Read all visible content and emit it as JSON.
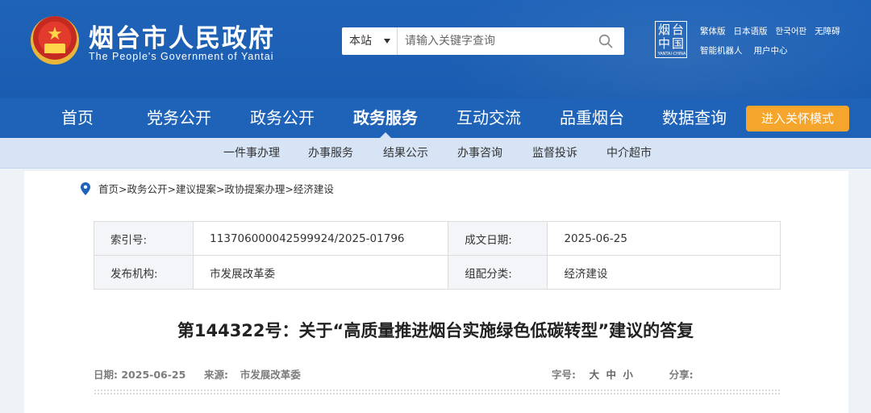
{
  "header": {
    "site_name": "烟台市人民政府",
    "site_name_en": "The People's Government of Yantai",
    "search": {
      "scope": "本站",
      "placeholder": "请输入关键字查询"
    },
    "china_logo": {
      "chars": "烟台中国",
      "en": "YANTAI·CHINA"
    },
    "top_links": [
      "繁体版",
      "日本语版",
      "한국어판",
      "无障碍"
    ],
    "top_links2": [
      "智能机器人",
      "用户中心"
    ]
  },
  "nav": {
    "items": [
      "首页",
      "党务公开",
      "政务公开",
      "政务服务",
      "互动交流",
      "品重烟台",
      "数据查询"
    ],
    "active_index": 3,
    "care_button": "进入关怀模式"
  },
  "subnav": {
    "items": [
      "一件事办理",
      "办事服务",
      "结果公示",
      "办事咨询",
      "监督投诉",
      "中介超市"
    ]
  },
  "breadcrumb": "首页>政务公开>建议提案>政协提案办理>经济建设",
  "meta": {
    "index_label": "索引号:",
    "index_value": "113706000042599924/2025-01796",
    "date_label": "成文日期:",
    "date_value": "2025-06-25",
    "org_label": "发布机构:",
    "org_value": "市发展改革委",
    "category_label": "组配分类:",
    "category_value": "经济建设"
  },
  "article": {
    "title": "第144322号：关于“高质量推进烟台实施绿色低碳转型”建议的答复",
    "date_label": "日期:",
    "date": "2025-06-25",
    "source_label": "来源:",
    "source": "市发展改革委",
    "fontsize_label": "字号:",
    "size_large": "大",
    "size_medium": "中",
    "size_small": "小",
    "share_label": "分享:"
  },
  "colors": {
    "header_blue": "#1f63b8",
    "subnav_bg": "#d6e4f5",
    "care_orange": "#f5a52b"
  }
}
